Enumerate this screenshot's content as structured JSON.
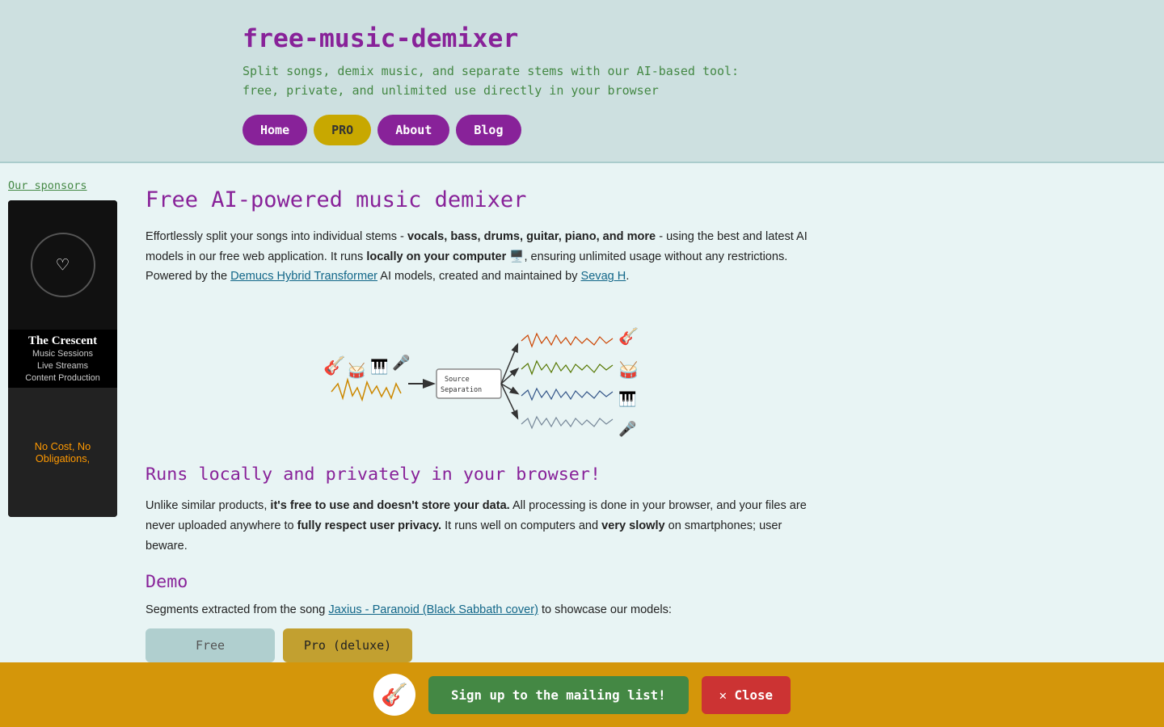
{
  "header": {
    "title": "free-music-demixer",
    "subtitle_line1": "Split songs, demix music, and separate stems with our AI-based tool:",
    "subtitle_line2": "free, private, and unlimited use directly in your browser"
  },
  "nav": {
    "home": "Home",
    "pro": "PRO",
    "about": "About",
    "blog": "Blog"
  },
  "sidebar": {
    "sponsors_label": "Our sponsors",
    "sponsor_name": "The Crescent",
    "sponsor_taglines": [
      "Music Sessions",
      "Live Streams",
      "Content Production"
    ],
    "sponsor_bottom_text": "No Cost, No Obligations,"
  },
  "main": {
    "heading": "Free AI-powered music demixer",
    "intro": {
      "part1": "Effortlessly split your songs into individual stems - ",
      "bold1": "vocals, bass, drums, guitar, piano, and more",
      "part2": " - using the best and latest AI models in our free web application. It runs ",
      "bold2": "locally on your computer",
      "part3": " 🖥️, ensuring unlimited usage without any restrictions. Powered by the ",
      "link1": "Demucs Hybrid Transformer",
      "part4": " AI models, created and maintained by ",
      "link2": "Sevag H",
      "part5": "."
    },
    "section1_heading": "Runs locally and privately in your browser!",
    "section1_text": {
      "part1": "Unlike similar products, ",
      "bold1": "it's free to use and doesn't store your data.",
      "part2": " All processing is done in your browser, and your files are never uploaded anywhere to ",
      "bold2": "fully respect user privacy.",
      "part3": " It runs well on computers and ",
      "bold3": "very slowly",
      "part4": " on smartphones; user beware."
    },
    "demo_heading": "Demo",
    "demo_text": {
      "part1": "Segments extracted from the song ",
      "link1": "Jaxius - Paranoid (Black Sabbath cover)",
      "part2": " to showcase our models:"
    },
    "demo_col_free": "Free",
    "demo_col_pro": "Pro (deluxe)"
  },
  "notification": {
    "icon": "🎸",
    "signup_label": "Sign up to the mailing list!",
    "close_label": "✕ Close"
  }
}
